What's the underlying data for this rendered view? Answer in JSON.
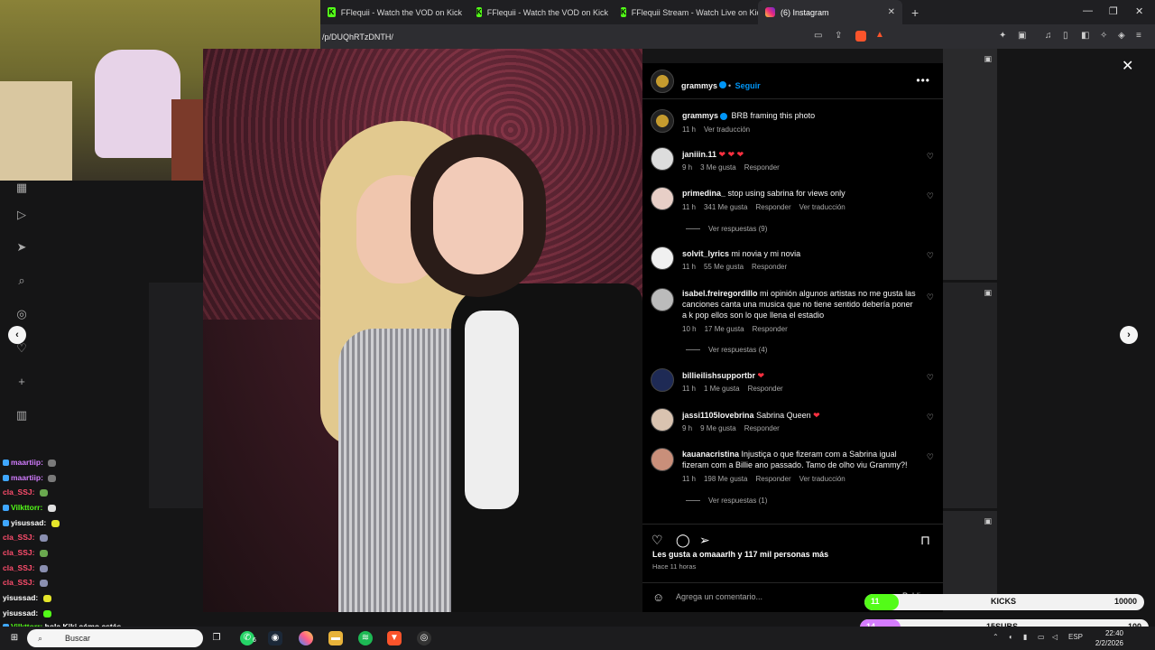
{
  "browser": {
    "tabs": [
      {
        "title": "FFlequii - Watch the VOD on Kick",
        "icon": "kick"
      },
      {
        "title": "FFlequii - Watch the VOD on Kick",
        "icon": "kick"
      },
      {
        "title": "FFlequii Stream - Watch Live on Kick",
        "icon": "kick"
      },
      {
        "title": "(6) Instagram",
        "icon": "instagram"
      }
    ],
    "url": "/p/DUQhRTzDNTH/"
  },
  "post": {
    "author": "grammys",
    "follow_label": "Seguir",
    "caption": "BRB framing this photo",
    "caption_time": "11 h",
    "translate_label": "Ver traducción",
    "likes_text": "Les gusta a omaaarlh y 117 mil personas más",
    "posted_ago": "Hace 11 horas",
    "comment_placeholder": "Agrega un comentario...",
    "accent_color": "#0095f6"
  },
  "comments": [
    {
      "user": "janiiin.11",
      "text": "",
      "hearts": "❤ ❤ ❤",
      "time": "9 h",
      "likes": "3 Me gusta",
      "reply": "Responder"
    },
    {
      "user": "primedina_",
      "text": "stop using sabrina for views only",
      "time": "11 h",
      "likes": "341 Me gusta",
      "reply": "Responder",
      "translate": "Ver traducción",
      "replies": "Ver respuestas (9)"
    },
    {
      "user": "solvit_lyrics",
      "text": "mi novia y mi novia",
      "time": "11 h",
      "likes": "55 Me gusta",
      "reply": "Responder"
    },
    {
      "user": "isabel.freiregordillo",
      "text": "mi opinión algunos artistas no me gusta las canciones canta una musica que no tiene sentido debería poner a k pop ellos son lo que llena el estadio",
      "time": "10 h",
      "likes": "17 Me gusta",
      "reply": "Responder",
      "replies": "Ver respuestas (4)"
    },
    {
      "user": "billieilishsupportbr",
      "text": "",
      "hearts": "❤",
      "time": "11 h",
      "likes": "1 Me gusta",
      "reply": "Responder"
    },
    {
      "user": "jassi1105lovebrina",
      "text": "Sabrina Queen",
      "hearts": "❤",
      "time": "9 h",
      "likes": "9 Me gusta",
      "reply": "Responder"
    },
    {
      "user": "kauanacristina",
      "text": "Injustiça o que fizeram com a Sabrina igual fizeram com a Billie ano passado. Tamo de olho viu Grammy?!",
      "time": "11 h",
      "likes": "198 Me gusta",
      "reply": "Responder",
      "translate": "Ver traducción",
      "replies": "Ver respuestas (1)"
    }
  ],
  "chat": [
    {
      "user": "maartiip",
      "color": "#d27cff",
      "emote": "#7a7a7a"
    },
    {
      "user": "maartiip",
      "color": "#d27cff",
      "emote": "#7a7a7a"
    },
    {
      "user": "cla_SSJ",
      "color": "#ff4d6d",
      "emote": "#6aa84f"
    },
    {
      "user": "Vilkttorr",
      "color": "#53fc18",
      "emote": "#e0e0e0"
    },
    {
      "user": "yisussad",
      "color": "#ffffff",
      "emote": "#e5e52a"
    },
    {
      "user": "cla_SSJ",
      "color": "#ff4d6d",
      "emote": "#8a8fb0"
    },
    {
      "user": "cla_SSJ",
      "color": "#ff4d6d",
      "emote": "#6aa84f"
    },
    {
      "user": "cla_SSJ",
      "color": "#ff4d6d",
      "emote": "#8a8fb0"
    },
    {
      "user": "cla_SSJ",
      "color": "#ff4d6d",
      "emote": "#8a8fb0"
    },
    {
      "user": "yisussad",
      "color": "#ffffff",
      "emote": "#e5e52a"
    },
    {
      "user": "yisussad",
      "color": "#ffffff",
      "emote": "#53fc18"
    }
  ],
  "chat_last": {
    "user": "Vilkttorr",
    "text": "hola Kiki cómo estás"
  },
  "goals": [
    {
      "count": "11",
      "label": "KICKS",
      "target": "10000",
      "progress": 0.1,
      "color": "#53fc18"
    },
    {
      "count": "14",
      "label": "15SUBS",
      "target": "100",
      "progress": 0.14,
      "color": "#d57cff"
    }
  ],
  "publish_label": "Publicar",
  "taskbar": {
    "search_label": "Buscar",
    "lang": "ESP",
    "time": "22:40",
    "date": "2/2/2026",
    "whatsapp_badge": "6"
  }
}
